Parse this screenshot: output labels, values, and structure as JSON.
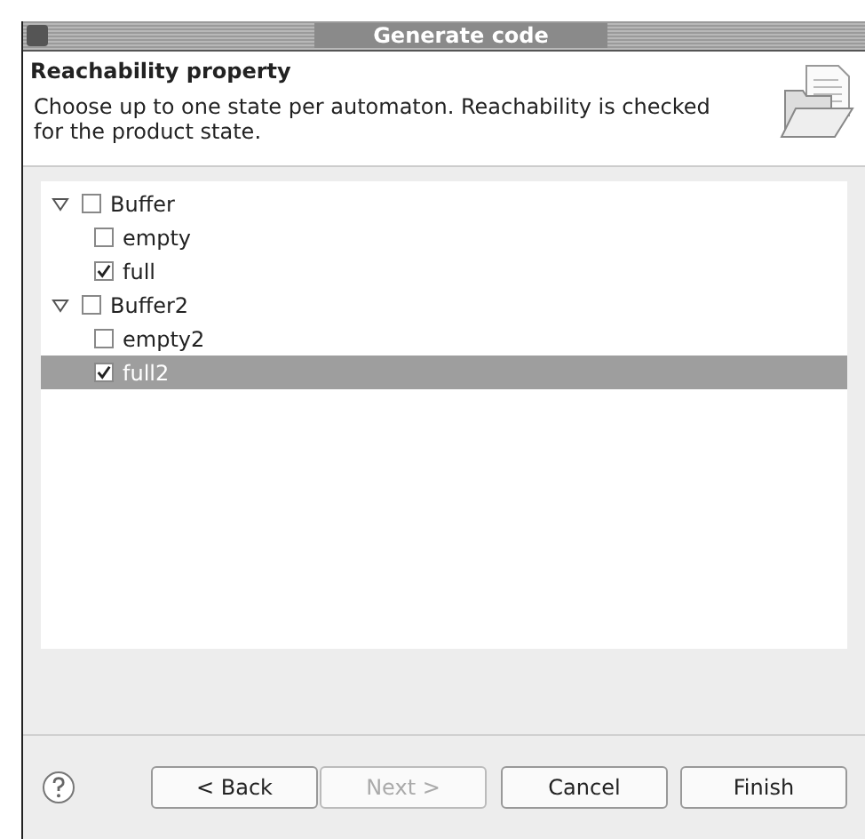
{
  "window": {
    "title": "Generate code"
  },
  "header": {
    "title": "Reachability property",
    "description": "Choose up to one state per automaton. Reachability is checked for the product state."
  },
  "tree": [
    {
      "label": "Buffer",
      "checked": false,
      "expanded": true,
      "selected": false,
      "children": [
        {
          "label": "empty",
          "checked": false,
          "selected": false
        },
        {
          "label": "full",
          "checked": true,
          "selected": false
        }
      ]
    },
    {
      "label": "Buffer2",
      "checked": false,
      "expanded": true,
      "selected": false,
      "children": [
        {
          "label": "empty2",
          "checked": false,
          "selected": false
        },
        {
          "label": "full2",
          "checked": true,
          "selected": true
        }
      ]
    }
  ],
  "buttons": [
    {
      "label": "< Back",
      "disabled": false
    },
    {
      "label": "Next >",
      "disabled": true
    },
    {
      "label": "Cancel",
      "disabled": false
    },
    {
      "label": "Finish",
      "disabled": false
    }
  ]
}
